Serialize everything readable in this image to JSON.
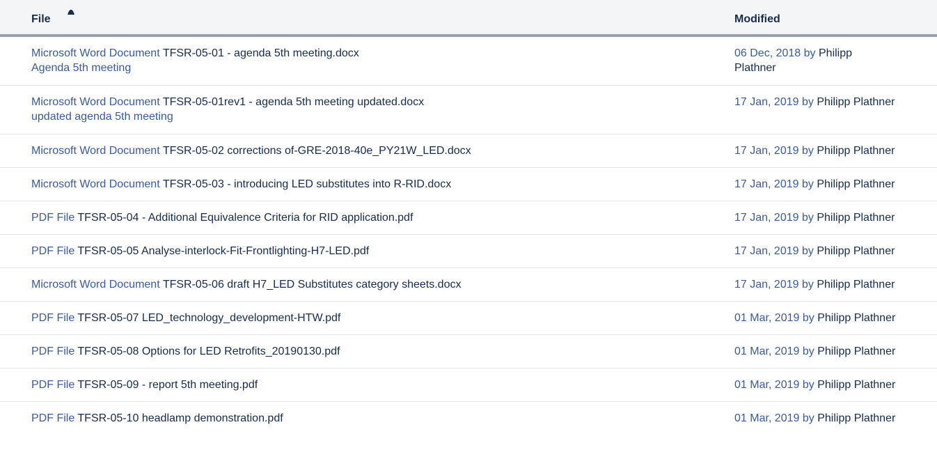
{
  "header": {
    "file_label": "File",
    "modified_label": "Modified",
    "sort_icon": "sort-ascending-icon"
  },
  "rows": [
    {
      "type_label": "Microsoft Word Document",
      "file_name": "TFSR-05-01 - agenda 5th meeting.docx",
      "comment": "Agenda 5th meeting",
      "date": "06 Dec, 2018",
      "by": "by",
      "author": "Philipp Plathner"
    },
    {
      "type_label": "Microsoft Word Document",
      "file_name": "TFSR-05-01rev1 - agenda 5th meeting updated.docx",
      "comment": "updated agenda 5th meeting",
      "date": "17 Jan, 2019",
      "by": "by",
      "author": "Philipp Plathner"
    },
    {
      "type_label": "Microsoft Word Document",
      "file_name": "TFSR-05-02 corrections of-GRE-2018-40e_PY21W_LED.docx",
      "date": "17 Jan, 2019",
      "by": "by",
      "author": "Philipp Plathner"
    },
    {
      "type_label": "Microsoft Word Document",
      "file_name": "TFSR-05-03 - introducing LED substitutes into R-RID.docx",
      "date": "17 Jan, 2019",
      "by": "by",
      "author": "Philipp Plathner"
    },
    {
      "type_label": "PDF File",
      "file_name": "TFSR-05-04 - Additional Equivalence Criteria for RID application.pdf",
      "date": "17 Jan, 2019",
      "by": "by",
      "author": "Philipp Plathner"
    },
    {
      "type_label": "PDF File",
      "file_name": "TFSR-05-05 Analyse-interlock-Fit-Frontlighting-H7-LED.pdf",
      "date": "17 Jan, 2019",
      "by": "by",
      "author": "Philipp Plathner"
    },
    {
      "type_label": "Microsoft Word Document",
      "file_name": "TFSR-05-06 draft H7_LED Substitutes category sheets.docx",
      "date": "17 Jan, 2019",
      "by": "by",
      "author": "Philipp Plathner"
    },
    {
      "type_label": "PDF File",
      "file_name": "TFSR-05-07 LED_technology_development-HTW.pdf",
      "date": "01 Mar, 2019",
      "by": "by",
      "author": "Philipp Plathner"
    },
    {
      "type_label": "PDF File",
      "file_name": "TFSR-05-08 Options for LED Retrofits_20190130.pdf",
      "date": "01 Mar, 2019",
      "by": "by",
      "author": "Philipp Plathner"
    },
    {
      "type_label": "PDF File",
      "file_name": "TFSR-05-09 - report 5th meeting.pdf",
      "date": "01 Mar, 2019",
      "by": "by",
      "author": "Philipp Plathner"
    },
    {
      "type_label": "PDF File",
      "file_name": "TFSR-05-10 headlamp demonstration.pdf",
      "date": "01 Mar, 2019",
      "by": "by",
      "author": "Philipp Plathner"
    }
  ]
}
